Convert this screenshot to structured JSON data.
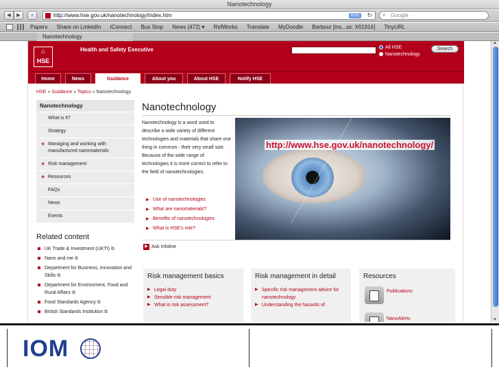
{
  "browser": {
    "window_title": "Nanotechnology",
    "url": "http://www.hse.gov.uk/nanotechnology/index.htm",
    "rss_label": "RSS",
    "search_placeholder": "Google",
    "bookmarks": [
      "Papers",
      "Share on LinkedIn",
      "iConnect",
      "Bus Stop",
      "News (472) ▾",
      "RefWorks",
      "Translate",
      "MyDoodle",
      "Barbour [ins...ss: X61916]",
      "TinyURL"
    ],
    "tab_title": "Nanotechnology"
  },
  "site": {
    "logo_abbr": "HSE",
    "org_name": "Health and Safety Executive",
    "search_options": [
      "All HSE",
      "Nanotechnology"
    ],
    "search_button": "Search",
    "nav_tabs": [
      "Home",
      "News",
      "Guidance",
      "About you",
      "About HSE",
      "Notify HSE"
    ],
    "active_tab": "Guidance",
    "breadcrumb": {
      "links": [
        "HSE",
        "Guidance",
        "Topics"
      ],
      "separator": "»",
      "current": "Nanotechnology"
    }
  },
  "left_menu": {
    "heading": "Nanotechnology",
    "items": [
      {
        "label": "What is it?",
        "plus": false
      },
      {
        "label": "Strategy",
        "plus": false
      },
      {
        "label": "Managing and working with manufactured nanomaterials",
        "plus": true
      },
      {
        "label": "Risk management",
        "plus": true
      },
      {
        "label": "Resources",
        "plus": true
      },
      {
        "label": "FAQs",
        "plus": false
      },
      {
        "label": "News",
        "plus": false
      },
      {
        "label": "Events",
        "plus": false
      }
    ]
  },
  "related": {
    "heading": "Related content",
    "items": [
      "UK Trade & Investment (UKTI)",
      "Nano and me",
      "Department for Business, Innovation and Skills",
      "Department for Environment, Food and Rural Affairs",
      "Food Standards Agency",
      "British Standards Institution"
    ]
  },
  "main": {
    "title": "Nanotechnology",
    "intro": "Nanotechnology is a word used to describe a wide variety of different technologies and materials that share one thing in common - their very small size. Because of the wide range of technologies it is more correct to refer to the field of nanotechnologies.",
    "links": [
      "Use of nanotechnologies",
      "What are nanomaterials?",
      "Benefits of nanotechnologies",
      "What is HSE's role?"
    ],
    "infoline": "Ask Infoline"
  },
  "boxes": [
    {
      "heading": "Risk management basics",
      "links": [
        "Legal duty",
        "Sensible risk management",
        "What is risk assessment?"
      ]
    },
    {
      "heading": "Risk management in detail",
      "links": [
        "Specific risk management advice for nanotechnology",
        "Understanding the hazards of"
      ]
    },
    {
      "heading": "Resources",
      "items": [
        "Publications",
        "NanoAlerts"
      ]
    }
  ],
  "overlay_url": "http://www.hse.gov.uk/nanotechnology/",
  "footer": {
    "logo_text": "IOM"
  },
  "colors": {
    "hse_red": "#b3001b",
    "overlay_red": "#c8102e",
    "iom_blue": "#1f3f8f"
  }
}
